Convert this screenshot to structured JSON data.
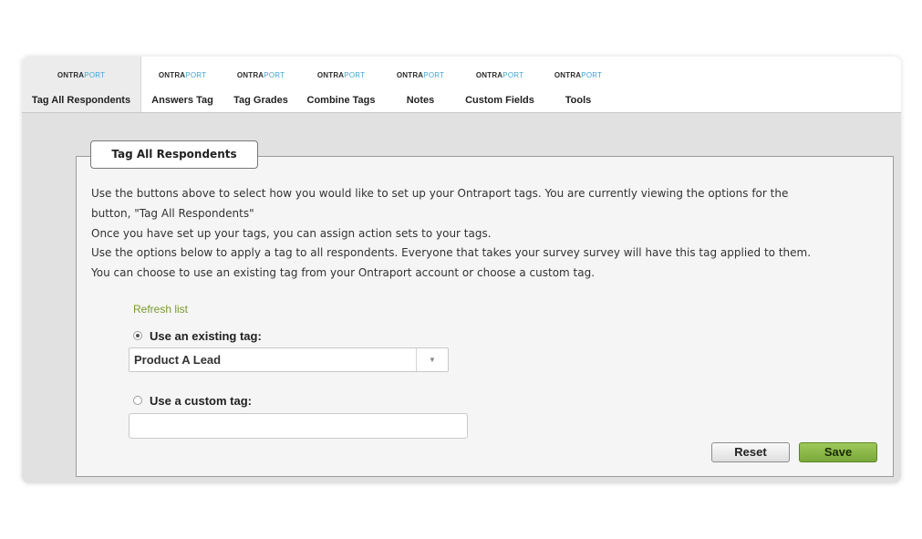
{
  "brand": {
    "logo_main": "ONTRA",
    "logo_accent": "PORT",
    "accent_color": "#3fa4d8"
  },
  "tabs": [
    {
      "label": "Tag All Respondents",
      "active": true
    },
    {
      "label": "Answers Tag"
    },
    {
      "label": "Tag Grades"
    },
    {
      "label": "Combine Tags"
    },
    {
      "label": "Notes"
    },
    {
      "label": "Custom Fields"
    },
    {
      "label": "Tools"
    }
  ],
  "panel": {
    "legend": "Tag All Respondents",
    "description": [
      "Use the buttons above to select how you would like to set up your Ontraport tags. You are currently viewing the options for the",
      "button, \"Tag All Respondents\"",
      "Once you have set up your tags, you can assign action sets to your tags.",
      "Use the options below to apply a tag to all respondents. Everyone that takes your survey survey will have this tag applied to them.",
      "You can choose to use an existing tag from your Ontraport account or choose a custom tag."
    ],
    "refresh_label": "Refresh list",
    "existing_tag_label": "Use an existing tag:",
    "existing_tag_selected": true,
    "existing_tag_value": "Product A Lead",
    "custom_tag_label": "Use a custom tag:",
    "custom_tag_value": ""
  },
  "buttons": {
    "reset": "Reset",
    "save": "Save"
  },
  "colors": {
    "save_green": "#8bb84a",
    "refresh_green": "#7a9a2a"
  }
}
